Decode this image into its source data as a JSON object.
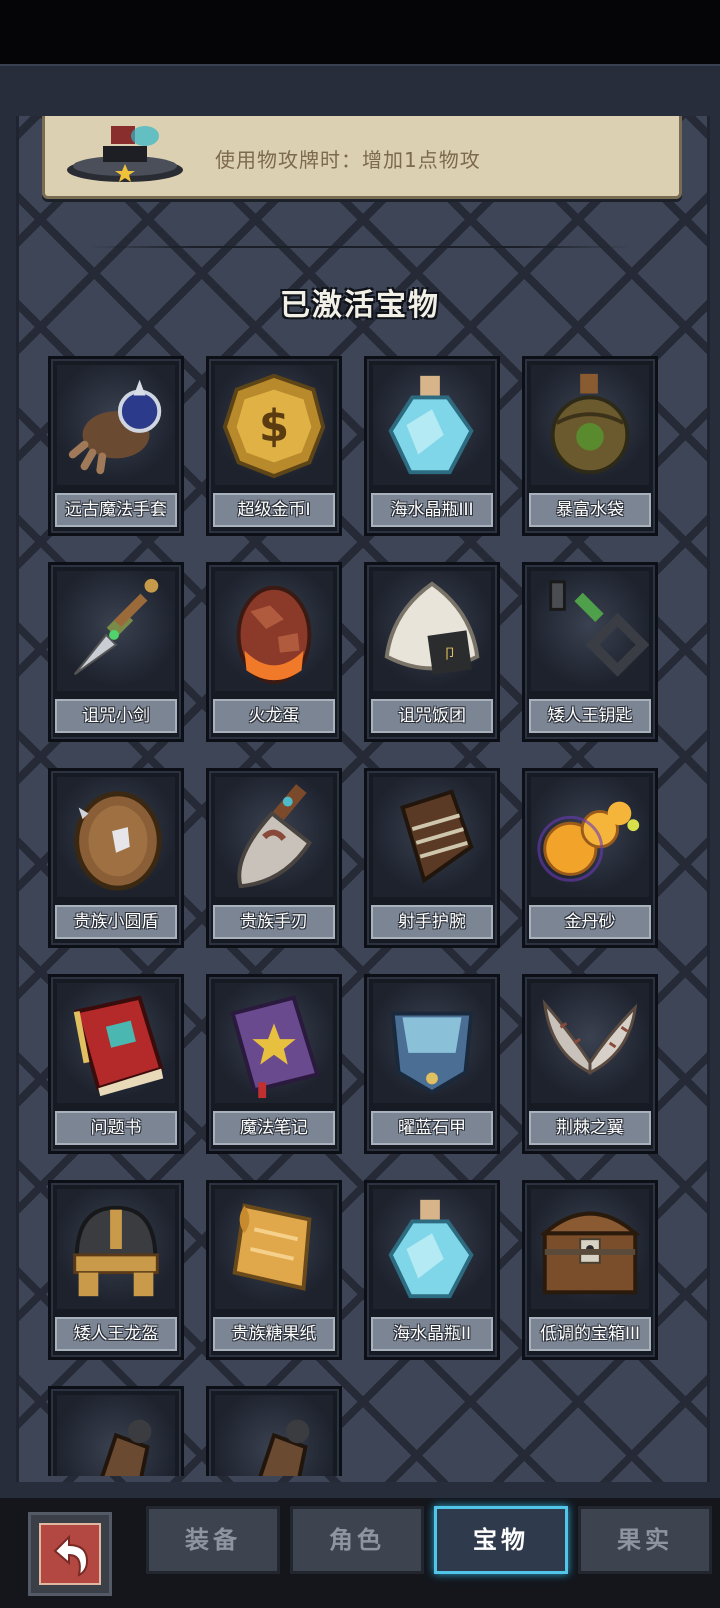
{
  "effect_card": {
    "description": "使用物攻牌时：增加1点物攻"
  },
  "section_title": "已激活宝物",
  "treasures": [
    {
      "name": "远古魔法手套",
      "icon": "spiked-gauntlet-icon"
    },
    {
      "name": "超级金币I",
      "icon": "gold-coin-icon"
    },
    {
      "name": "海水晶瓶III",
      "icon": "crystal-bottle-icon"
    },
    {
      "name": "暴富水袋",
      "icon": "water-flask-icon"
    },
    {
      "name": "诅咒小剑",
      "icon": "dagger-icon"
    },
    {
      "name": "火龙蛋",
      "icon": "dragon-egg-icon"
    },
    {
      "name": "诅咒饭团",
      "icon": "rice-ball-icon"
    },
    {
      "name": "矮人王钥匙",
      "icon": "key-icon"
    },
    {
      "name": "贵族小圆盾",
      "icon": "round-shield-icon"
    },
    {
      "name": "贵族手刃",
      "icon": "cleaver-icon"
    },
    {
      "name": "射手护腕",
      "icon": "bracer-icon"
    },
    {
      "name": "金丹砂",
      "icon": "golden-orbs-icon"
    },
    {
      "name": "问题书",
      "icon": "red-book-icon"
    },
    {
      "name": "魔法笔记",
      "icon": "purple-book-icon"
    },
    {
      "name": "曜蓝石甲",
      "icon": "blue-armor-icon"
    },
    {
      "name": "荆棘之翼",
      "icon": "thorn-wings-icon"
    },
    {
      "name": "矮人王龙盔",
      "icon": "helmet-icon"
    },
    {
      "name": "贵族糖果纸",
      "icon": "candy-paper-icon"
    },
    {
      "name": "海水晶瓶II",
      "icon": "crystal-bottle-icon"
    },
    {
      "name": "低调的宝箱III",
      "icon": "treasure-chest-icon"
    },
    {
      "name": "",
      "icon": "gauntlet-icon"
    },
    {
      "name": "",
      "icon": "gauntlet-icon"
    }
  ],
  "tabs": [
    {
      "label": "装备",
      "active": false
    },
    {
      "label": "角色",
      "active": false
    },
    {
      "label": "宝物",
      "active": true
    },
    {
      "label": "果实",
      "active": false
    }
  ],
  "colors": {
    "panel_bg": "#272d3b",
    "card_bg": "#161a23",
    "label_bg": "#7c8594",
    "active_tab_glow": "#52c6e8",
    "back_button": "#b24841"
  }
}
